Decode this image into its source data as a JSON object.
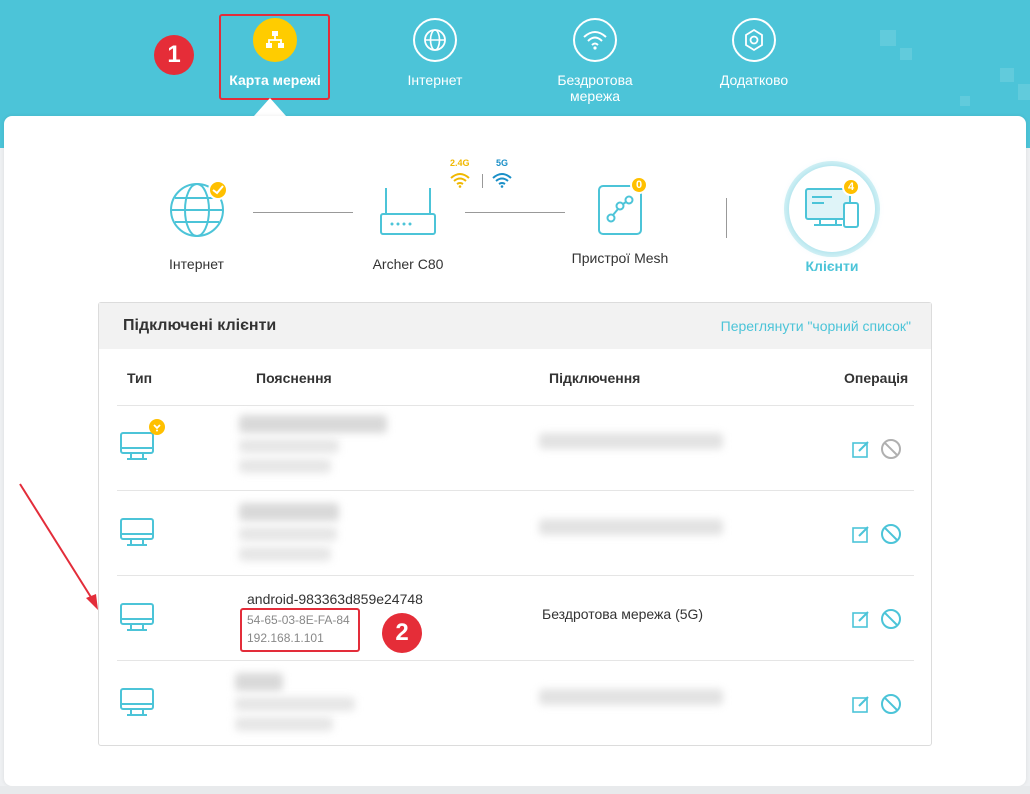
{
  "nav": {
    "items": [
      {
        "label": "Карта мережі",
        "icon": "network-map-icon",
        "active": true
      },
      {
        "label": "Інтернет",
        "icon": "globe-icon"
      },
      {
        "label": "Бездротова мережа",
        "icon": "wifi-icon"
      },
      {
        "label": "Додатково",
        "icon": "gear-icon"
      }
    ]
  },
  "annotations": {
    "step1": "1",
    "step2": "2"
  },
  "topology": {
    "internet": {
      "label": "Інтернет",
      "icon": "globe-icon"
    },
    "router": {
      "label": "Archer C80",
      "icon": "router-icon"
    },
    "band_24": "2.4G",
    "band_5": "5G",
    "mesh": {
      "label": "Пристрої Mesh",
      "icon": "mesh-icon",
      "count": "0"
    },
    "clients": {
      "label": "Клієнти",
      "icon": "monitor-icon",
      "count": "4"
    }
  },
  "panel": {
    "title": "Підключені клієнти",
    "blacklist_link": "Переглянути \"чорний список\"",
    "columns": {
      "type": "Тип",
      "description": "Пояснення",
      "connection": "Підключення",
      "operation": "Операція"
    },
    "rows": [
      {
        "name": "",
        "mac": "",
        "ip": "",
        "connection": "",
        "blurred": true,
        "has_badge": true
      },
      {
        "name": "",
        "mac": "",
        "ip": "",
        "connection": "",
        "blurred": true
      },
      {
        "name": "android-983363d859e24748",
        "mac": "54-65-03-8E-FA-84",
        "ip": "192.168.1.101",
        "connection": "Бездротова мережа (5G)",
        "blurred": false
      },
      {
        "name": "",
        "mac": "",
        "ip": "",
        "connection": "",
        "blurred": true
      }
    ]
  },
  "colors": {
    "accent": "#4cc4d8",
    "active": "#ffcc00",
    "highlight": "#e32d3a",
    "badge": "#ffc000"
  }
}
